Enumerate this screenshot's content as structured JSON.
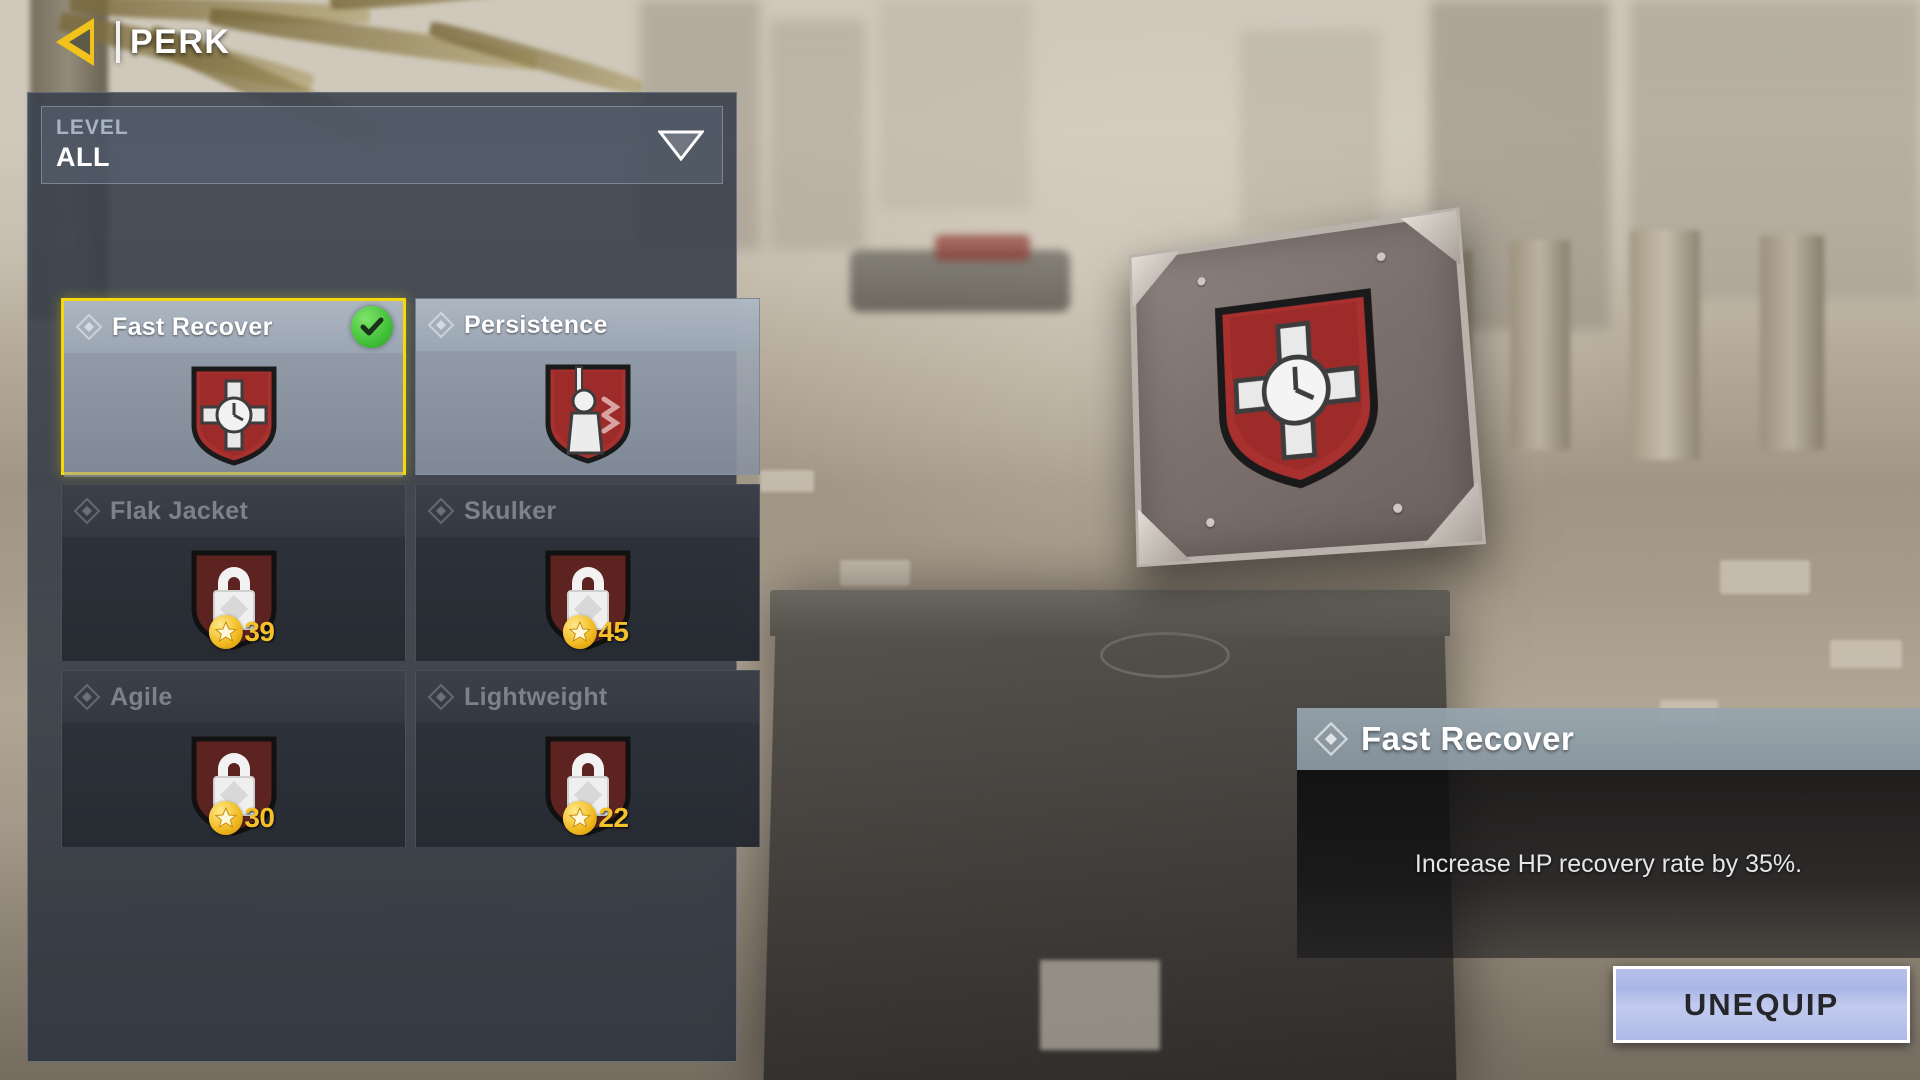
{
  "header": {
    "title": "PERK",
    "back_icon": "back-arrow-icon"
  },
  "filter": {
    "label": "LEVEL",
    "value": "ALL",
    "caret_icon": "chevron-down-icon"
  },
  "perks": [
    {
      "name": "Fast Recover",
      "state": "equipped",
      "selected": true,
      "locked": false,
      "unlock_level": "",
      "status_icon": "check-icon",
      "emblem_icon": "fast-recover-emblem"
    },
    {
      "name": "Persistence",
      "state": "unlocked",
      "selected": false,
      "locked": false,
      "unlock_level": "",
      "status_icon": "",
      "emblem_icon": "persistence-emblem"
    },
    {
      "name": "Flak Jacket",
      "state": "locked",
      "selected": false,
      "locked": true,
      "unlock_level": "39",
      "status_icon": "lock-icon",
      "emblem_icon": "locked-emblem"
    },
    {
      "name": "Skulker",
      "state": "locked",
      "selected": false,
      "locked": true,
      "unlock_level": "45",
      "status_icon": "lock-icon",
      "emblem_icon": "locked-emblem"
    },
    {
      "name": "Agile",
      "state": "locked",
      "selected": false,
      "locked": true,
      "unlock_level": "30",
      "status_icon": "lock-icon",
      "emblem_icon": "locked-emblem"
    },
    {
      "name": "Lightweight",
      "state": "locked",
      "selected": false,
      "locked": true,
      "unlock_level": "22",
      "status_icon": "lock-icon",
      "emblem_icon": "locked-emblem"
    }
  ],
  "detail": {
    "title": "Fast Recover",
    "description": "Increase HP recovery rate by 35%.",
    "diamond_icon": "diamond-icon"
  },
  "action": {
    "unequip_label": "UNEQUIP"
  },
  "colors": {
    "accent_yellow": "#f5d90a",
    "check_green": "#3aba32",
    "star_gold": "#f0b81e",
    "level_text": "#f5c12a",
    "button_blue": "#b6c0ea",
    "panel_blue_gray": "#3a424e"
  }
}
